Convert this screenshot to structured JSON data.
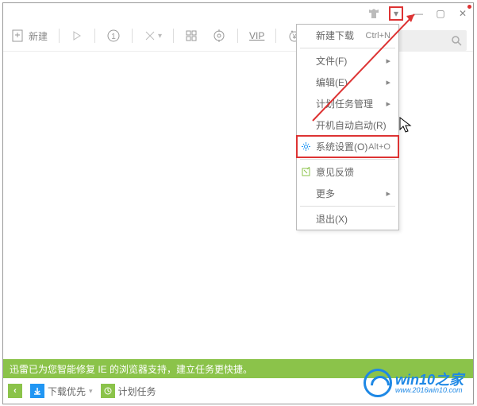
{
  "titlebar": {
    "skin_dot_color": "#d33",
    "drop_glyph": "▾",
    "min_glyph": "—",
    "max_glyph": "▢",
    "close_glyph": "✕"
  },
  "toolbar": {
    "new_label": "新建",
    "dots_glyph": "⋮⋮",
    "vip_label": "VIP"
  },
  "search": {
    "placeholder": ""
  },
  "menu": {
    "items": [
      {
        "label": "新建下载",
        "shortcut": "Ctrl+N",
        "icon": "",
        "submenu": false,
        "highlighted": false
      },
      {
        "sep": true
      },
      {
        "label": "文件(F)",
        "shortcut": "",
        "icon": "",
        "submenu": true,
        "highlighted": false
      },
      {
        "label": "编辑(E)",
        "shortcut": "",
        "icon": "",
        "submenu": true,
        "highlighted": false
      },
      {
        "label": "计划任务管理",
        "shortcut": "",
        "icon": "",
        "submenu": true,
        "highlighted": false
      },
      {
        "label": "开机自动启动(R)",
        "shortcut": "",
        "icon": "",
        "submenu": false,
        "highlighted": false
      },
      {
        "label": "系统设置(O)",
        "shortcut": "Alt+O",
        "icon": "gear",
        "submenu": false,
        "highlighted": true
      },
      {
        "sep": true
      },
      {
        "label": "意见反馈",
        "shortcut": "",
        "icon": "feedback",
        "submenu": false,
        "highlighted": false
      },
      {
        "label": "更多",
        "shortcut": "",
        "icon": "",
        "submenu": true,
        "highlighted": false
      },
      {
        "sep": true
      },
      {
        "label": "退出(X)",
        "shortcut": "",
        "icon": "",
        "submenu": false,
        "highlighted": false
      }
    ]
  },
  "status": {
    "text": "迅雷已为您智能修复 IE 的浏览器支持，建立任务更快捷。"
  },
  "bottombar": {
    "expand_glyph": "‹",
    "item1_label": "下载优先",
    "item2_label": "计划任务"
  },
  "watermark": {
    "brand_top": "win10之家",
    "brand_bottom": "www.2016win10.com"
  }
}
